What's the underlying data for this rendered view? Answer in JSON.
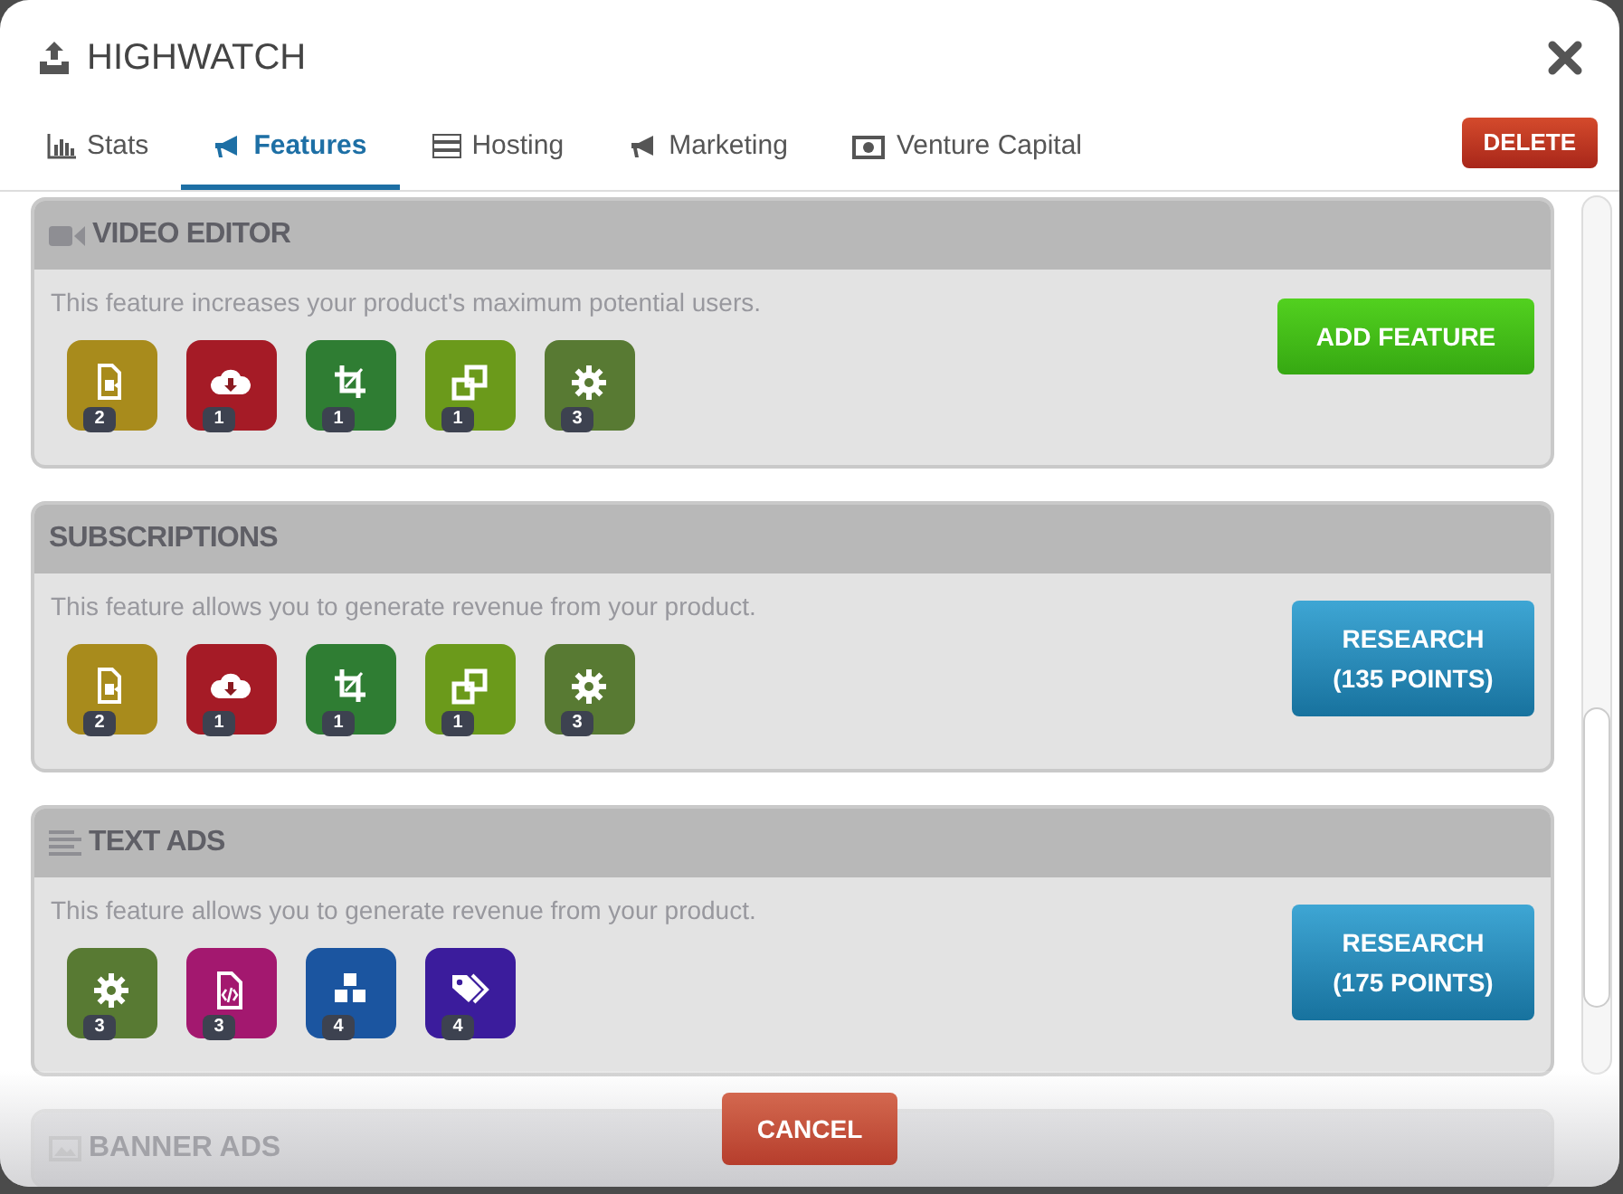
{
  "window": {
    "title": "HIGHWATCH"
  },
  "tabs": [
    {
      "label": "Stats",
      "kind": "chart",
      "selected": false
    },
    {
      "label": "Features",
      "kind": "megaphone",
      "selected": true
    },
    {
      "label": "Hosting",
      "kind": "server",
      "selected": false
    },
    {
      "label": "Marketing",
      "kind": "megaphone",
      "selected": false
    },
    {
      "label": "Venture Capital",
      "kind": "money",
      "selected": false
    }
  ],
  "delete_button": "DELETE",
  "features": [
    {
      "title": "VIDEO EDITOR",
      "kind": "video",
      "partial": false,
      "description": "This feature increases your product's maximum potential users.",
      "action": {
        "kind": "add",
        "lines": [
          "ADD FEATURE"
        ]
      },
      "requirements": [
        {
          "kind": "file-video",
          "color": "#a88b1c",
          "count": "2"
        },
        {
          "kind": "cloud-download",
          "color": "#a51b26",
          "count": "1"
        },
        {
          "kind": "crop",
          "color": "#2f7d33",
          "count": "1"
        },
        {
          "kind": "clone",
          "color": "#6b9a1b",
          "count": "1"
        },
        {
          "kind": "gear",
          "color": "#587a33",
          "count": "3"
        }
      ]
    },
    {
      "title": "SUBSCRIPTIONS",
      "kind": "plain",
      "partial": false,
      "description": "This feature allows you to generate revenue from your product.",
      "action": {
        "kind": "research",
        "lines": [
          "RESEARCH",
          "(135 POINTS)"
        ]
      },
      "requirements": [
        {
          "kind": "file-video",
          "color": "#a88b1c",
          "count": "2"
        },
        {
          "kind": "cloud-download",
          "color": "#a51b26",
          "count": "1"
        },
        {
          "kind": "crop",
          "color": "#2f7d33",
          "count": "1"
        },
        {
          "kind": "clone",
          "color": "#6b9a1b",
          "count": "1"
        },
        {
          "kind": "gear",
          "color": "#587a33",
          "count": "3"
        }
      ]
    },
    {
      "title": "TEXT ADS",
      "kind": "lines",
      "partial": false,
      "description": "This feature allows you to generate revenue from your product.",
      "action": {
        "kind": "research",
        "lines": [
          "RESEARCH",
          "(175 POINTS)"
        ]
      },
      "requirements": [
        {
          "kind": "gear",
          "color": "#587a33",
          "count": "3"
        },
        {
          "kind": "file-code",
          "color": "#a3186f",
          "count": "3"
        },
        {
          "kind": "cubes",
          "color": "#1b55a0",
          "count": "4"
        },
        {
          "kind": "tags",
          "color": "#3b1c9c",
          "count": "4"
        }
      ]
    },
    {
      "title": "BANNER ADS",
      "kind": "image",
      "partial": true
    }
  ],
  "cancel_button": "CANCEL"
}
